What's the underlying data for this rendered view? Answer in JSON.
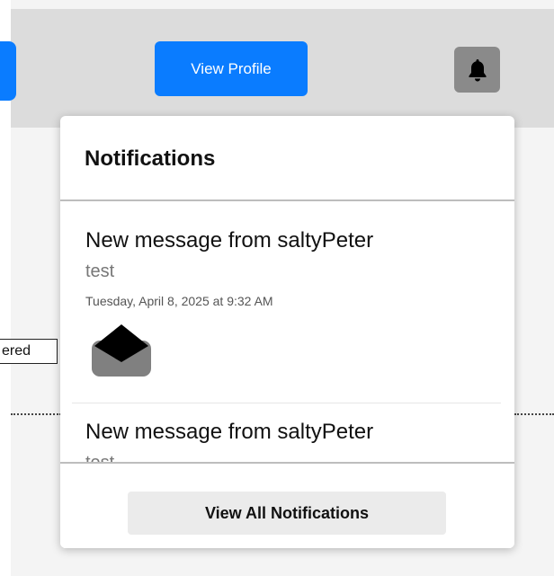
{
  "header": {
    "view_profile_label": "View Profile"
  },
  "background": {
    "partial_text": "ered"
  },
  "notifications": {
    "title": "Notifications",
    "items": [
      {
        "message": "New message from saltyPeter",
        "body": "test",
        "timestamp": "Tuesday, April 8, 2025 at 9:32 AM",
        "icon": "envelope-open-icon"
      },
      {
        "message": "New message from saltyPeter",
        "body": "test"
      }
    ],
    "view_all_label": "View All Notifications"
  },
  "colors": {
    "primary": "#0a7cff",
    "topbar": "#dcdcdc",
    "bell_bg": "#8a8a8a",
    "secondary_button": "#ebebeb"
  }
}
